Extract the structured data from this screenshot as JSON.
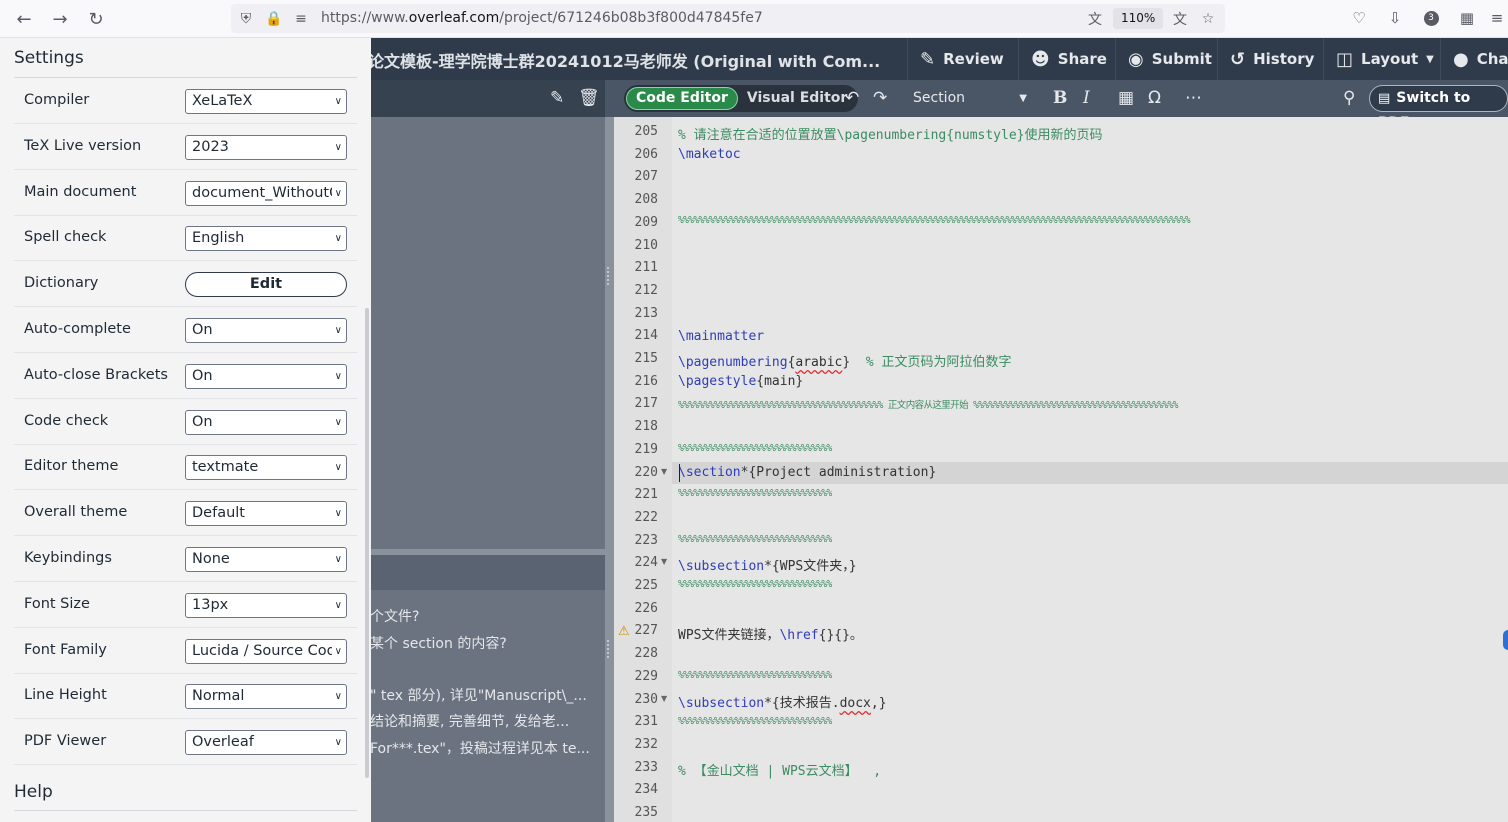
{
  "browser": {
    "url_prefix": "https://www.",
    "url_domain": "overleaf.com",
    "url_path": "/project/671246b08b3f800d47845fe7",
    "zoom": "110%",
    "extensions_count": "3"
  },
  "header": {
    "project_title": "论文模板-理学院博士群20241012马老师发 (Original with Com...",
    "review": "Review",
    "share": "Share",
    "submit": "Submit",
    "history": "History",
    "layout": "Layout",
    "chat": "Cha"
  },
  "toolbar": {
    "code_editor": "Code Editor",
    "visual_editor": "Visual Editor",
    "section": "Section",
    "switch_pdf": "Switch to PDF"
  },
  "outline_lines": [
    "个文件?",
    "某个 section 的内容?",
    "\" tex 部分), 详见\"Manuscript\\_...",
    "结论和摘要, 完善细节, 发给老...",
    "For***.tex\"，投稿过程详见本 te..."
  ],
  "settings": {
    "title": "Settings",
    "help": "Help",
    "rows": [
      {
        "label": "Compiler",
        "value": "XeLaTeX"
      },
      {
        "label": "TeX Live version",
        "value": "2023"
      },
      {
        "label": "Main document",
        "value": "document_WithoutC"
      },
      {
        "label": "Spell check",
        "value": "English"
      },
      {
        "label": "Dictionary",
        "value": "Edit"
      },
      {
        "label": "Auto-complete",
        "value": "On"
      },
      {
        "label": "Auto-close Brackets",
        "value": "On"
      },
      {
        "label": "Code check",
        "value": "On"
      },
      {
        "label": "Editor theme",
        "value": "textmate"
      },
      {
        "label": "Overall theme",
        "value": "Default"
      },
      {
        "label": "Keybindings",
        "value": "None"
      },
      {
        "label": "Font Size",
        "value": "13px"
      },
      {
        "label": "Font Family",
        "value": "Lucida / Source Cod"
      },
      {
        "label": "Line Height",
        "value": "Normal"
      },
      {
        "label": "PDF Viewer",
        "value": "Overleaf"
      }
    ]
  },
  "code": {
    "line_numbers": [
      "205",
      "206",
      "207",
      "208",
      "209",
      "210",
      "211",
      "212",
      "213",
      "214",
      "215",
      "216",
      "217",
      "218",
      "219",
      "220",
      "221",
      "222",
      "223",
      "224",
      "225",
      "226",
      "227",
      "228",
      "229",
      "230",
      "231",
      "232",
      "233",
      "234",
      "235"
    ],
    "l205": "% 请注意在合适的位置放置\\pagenumbering{numstyle}使用新的页码",
    "l206": "\\maketoc",
    "l209": "%%%%%%%%%%%%%%%%%%%%%%%%%%%%%%%%%%%%%%%%%%%%%%%%%%%%%%%%%%%%%%%%%%%%%%%%%%%%%%%%%%%%%%%%%%%%%%%%%%%%",
    "l214": "\\mainmatter",
    "l215_cmd": "\\pagenumbering",
    "l215_arg": "arabic",
    "l215_cmt": "% 正文页码为阿拉伯数字",
    "l216_cmd": "\\pagestyle",
    "l216_arg": "main",
    "l217": "%%%%%%%%%%%%%%%%%%%%%%%%%%%%%%%%%%%%%%%% 正文内容从这里开始 %%%%%%%%%%%%%%%%%%%%%%%%%%%%%%%%%%%%%%%%",
    "l219": "%%%%%%%%%%%%%%%%%%%%%%%%%%%%%%",
    "l220_cmd": "\\section",
    "l220_rest": "*{Project administration}",
    "l221": "%%%%%%%%%%%%%%%%%%%%%%%%%%%%%%",
    "l223": "%%%%%%%%%%%%%%%%%%%%%%%%%%%%%%",
    "l224_cmd": "\\subsection",
    "l224_rest": "*{WPS文件夹，}",
    "l225": "%%%%%%%%%%%%%%%%%%%%%%%%%%%%%%",
    "l227_pre": "WPS文件夹链接，",
    "l227_cmd": "\\href",
    "l227_rest": "{}{}。",
    "l229": "%%%%%%%%%%%%%%%%%%%%%%%%%%%%%%",
    "l230_cmd": "\\subsection",
    "l230_a": "*{技术报告.",
    "l230_b": "docx",
    "l230_c": ",}",
    "l231": "%%%%%%%%%%%%%%%%%%%%%%%%%%%%%%",
    "l233": "% 【金山文档 | WPS云文档】  ,"
  }
}
